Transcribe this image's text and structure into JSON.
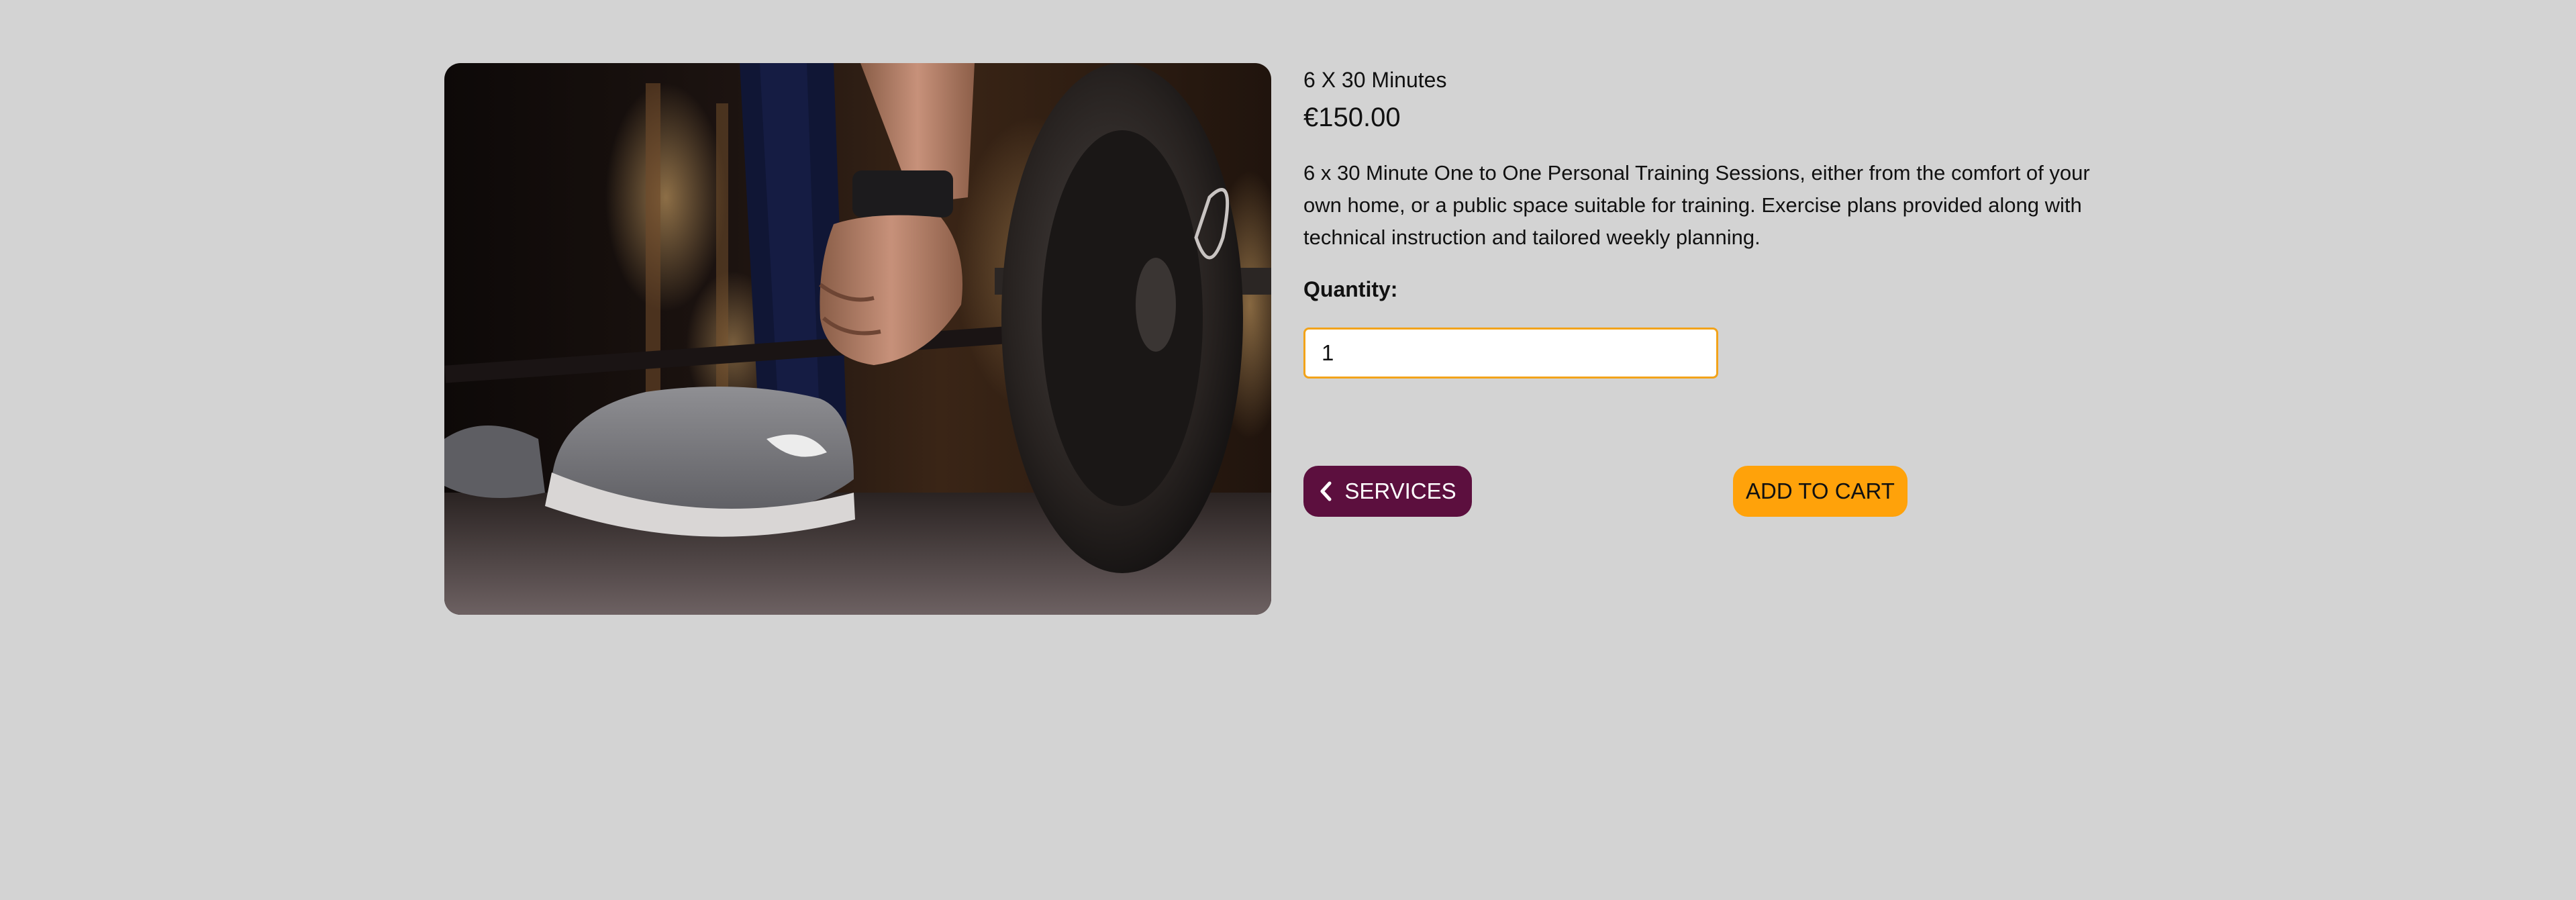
{
  "product": {
    "name": "6 X 30 Minutes",
    "price": "€150.00",
    "description": "6 x 30 Minute One to One Personal Training Sessions, either from the comfort of your own home, or a public space suitable for training. Exercise plans provided along with technical instruction and tailored weekly planning.",
    "image_icon": "gym-barbell-photo"
  },
  "quantity": {
    "label": "Quantity:",
    "value": "1"
  },
  "actions": {
    "services_label": "SERVICES",
    "services_icon": "chevron-left-icon",
    "add_to_cart_label": "ADD TO CART"
  },
  "colors": {
    "background": "#d3d3d3",
    "services_button": "#5c0f3e",
    "add_to_cart_button": "#ffa20a",
    "input_border": "#f2a31a"
  }
}
